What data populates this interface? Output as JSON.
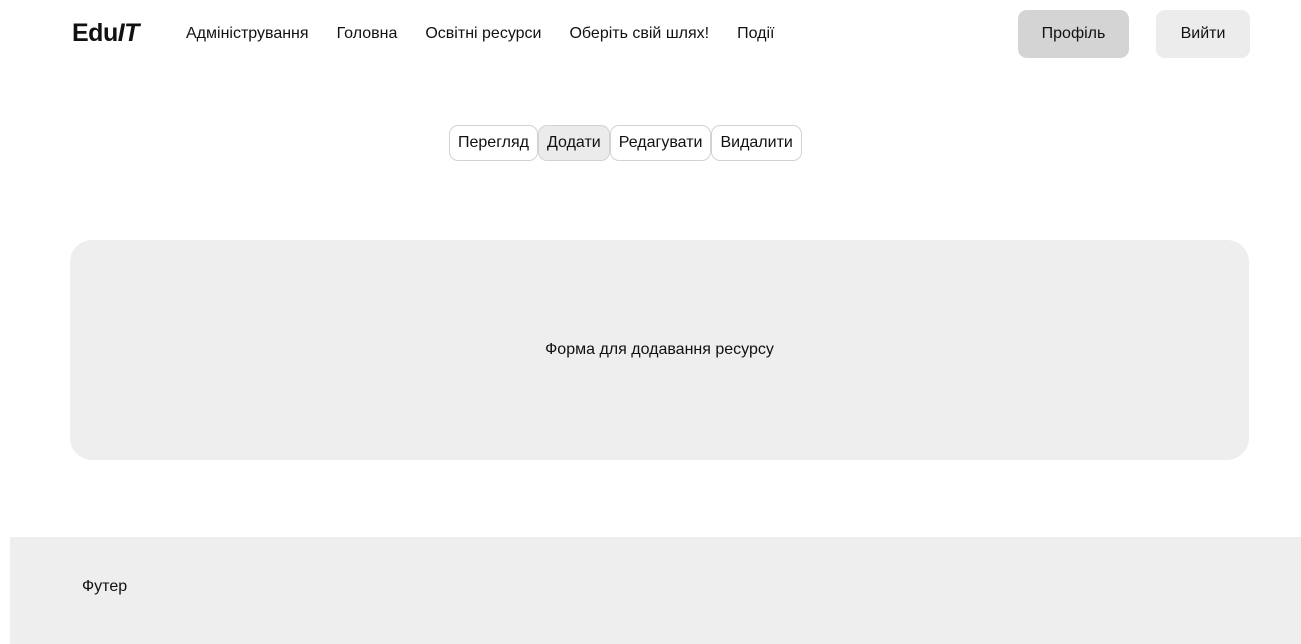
{
  "header": {
    "logo_main": "Edu",
    "logo_accent": "IT",
    "nav": [
      {
        "label": "Адміністрування"
      },
      {
        "label": "Головна"
      },
      {
        "label": "Освітні ресурси"
      },
      {
        "label": "Оберіть свій шлях!"
      },
      {
        "label": "Події"
      }
    ],
    "profile_label": "Профіль",
    "logout_label": "Вийти"
  },
  "tabs": [
    {
      "label": "Перегляд",
      "active": false
    },
    {
      "label": "Додати",
      "active": true
    },
    {
      "label": "Редагувати",
      "active": false
    },
    {
      "label": "Видалити",
      "active": false
    }
  ],
  "main": {
    "form_placeholder_text": "Форма для додавання ресурсу"
  },
  "footer": {
    "label": "Футер"
  }
}
